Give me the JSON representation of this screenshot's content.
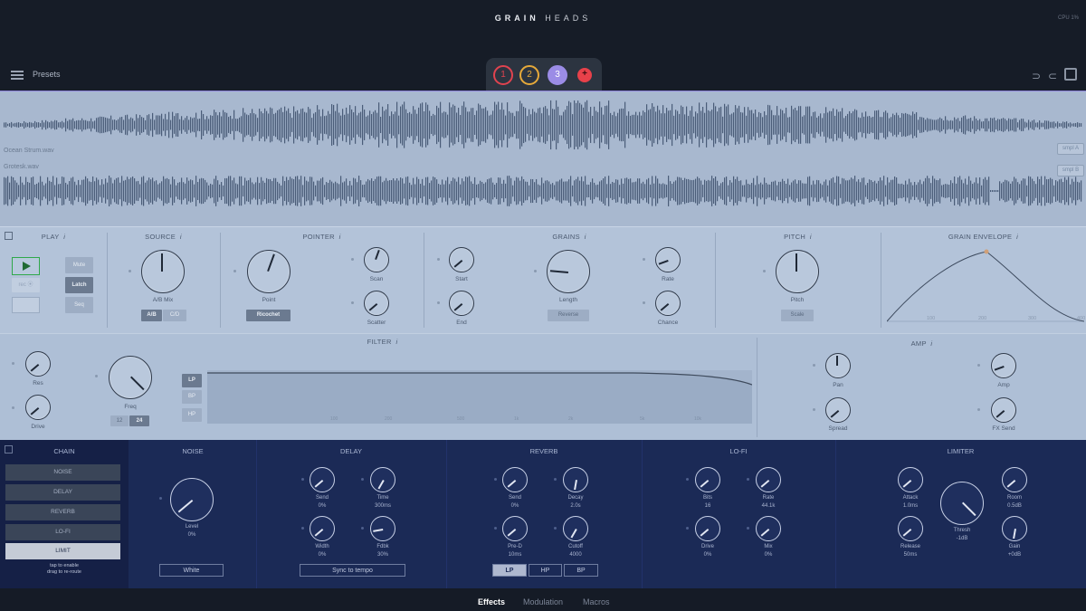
{
  "app": {
    "logo_a": "GRAIN",
    "logo_b": "HEADS",
    "cpu": "CPU 1%"
  },
  "header": {
    "presets": "Presets",
    "slots": [
      "1",
      "2",
      "3",
      "+"
    ]
  },
  "samples": {
    "a_name": "Ocean Strum.wav",
    "b_name": "Grotesk.wav",
    "a_btn": "smpl A",
    "b_btn": "smpl B"
  },
  "sections": {
    "play": "PLAY",
    "source": "SOURCE",
    "pointer": "POINTER",
    "grains": "GRAINS",
    "pitch": "PITCH",
    "envelope": "GRAIN ENVELOPE",
    "filter": "FILTER",
    "amp": "AMP",
    "info": "i"
  },
  "play": {
    "mute": "Mute",
    "latch": "Latch",
    "seq": "Seq",
    "rec": "rec ⦿"
  },
  "source": {
    "knob": "A/B Mix",
    "ab": "A/B",
    "cd": "C/D"
  },
  "pointer": {
    "point": "Point",
    "mode": "Ricochet",
    "scan": "Scan",
    "scatter": "Scatter"
  },
  "grains": {
    "start": "Start",
    "end": "End",
    "length": "Length",
    "reverse": "Reverse",
    "rate": "Rate",
    "chance": "Chance"
  },
  "pitch": {
    "knob": "Pitch",
    "scale": "Scale"
  },
  "envelope": {
    "ticks": [
      "100",
      "200",
      "300",
      "400"
    ]
  },
  "filter": {
    "res": "Res",
    "drive": "Drive",
    "freq": "Freq",
    "slope12": "12",
    "slope24": "24",
    "lp": "LP",
    "bp": "BP",
    "hp": "HP",
    "ticks": [
      "100",
      "200",
      "500",
      "1k",
      "2k",
      "5k",
      "10k"
    ]
  },
  "amp": {
    "pan": "Pan",
    "spread": "Spread",
    "amp": "Amp",
    "fxsend": "FX Send"
  },
  "chain": {
    "title": "CHAIN",
    "items": [
      "NOISE",
      "DELAY",
      "REVERB",
      "LO-FI",
      "LIMIT"
    ],
    "hint1": "tap to enable",
    "hint2": "drag to re-route"
  },
  "noise": {
    "title": "NOISE",
    "level": "Level",
    "level_val": "0%",
    "type": "White"
  },
  "delay": {
    "title": "DELAY",
    "send": "Send",
    "send_val": "0%",
    "time": "Time",
    "time_val": "300ms",
    "width": "Width",
    "width_val": "0%",
    "fdbk": "Fdbk",
    "fdbk_val": "30%",
    "sync": "Sync to tempo"
  },
  "reverb": {
    "title": "REVERB",
    "send": "Send",
    "send_val": "0%",
    "decay": "Decay",
    "decay_val": "2.0s",
    "pred": "Pre-D",
    "pred_val": "10ms",
    "cutoff": "Cutoff",
    "cutoff_val": "4000",
    "lp": "LP",
    "hp": "HP",
    "bp": "BP"
  },
  "lofi": {
    "title": "LO-FI",
    "bits": "Bits",
    "bits_val": "16",
    "rate": "Rate",
    "rate_val": "44.1k",
    "drive": "Drive",
    "drive_val": "0%",
    "mix": "Mix",
    "mix_val": "0%"
  },
  "limiter": {
    "title": "LIMITER",
    "attack": "Attack",
    "attack_val": "1.0ms",
    "room": "Room",
    "room_val": "0.5dB",
    "thresh": "Thresh",
    "thresh_val": "-1dB",
    "release": "Release",
    "release_val": "50ms",
    "gain": "Gain",
    "gain_val": "+0dB"
  },
  "tabs": {
    "effects": "Effects",
    "modulation": "Modulation",
    "macros": "Macros"
  },
  "colors": {
    "slot1": "#e0434f",
    "slot2": "#e6a93a",
    "slot3": "#9b8ce6",
    "add": "#e8414a",
    "play_green": "#2fa84a"
  }
}
